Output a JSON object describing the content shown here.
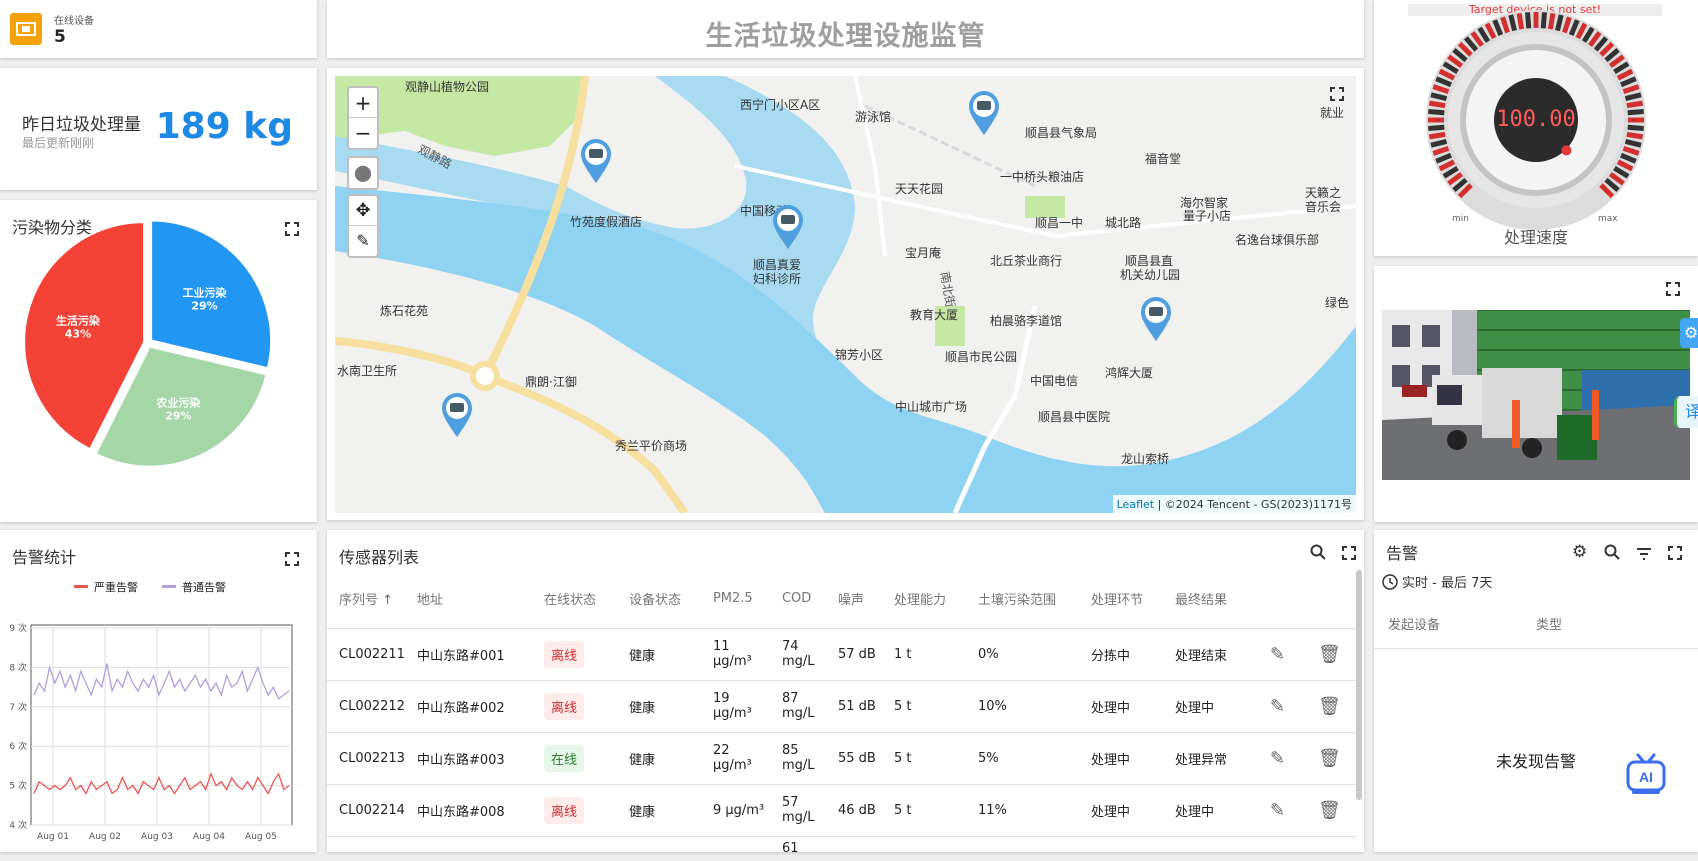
{
  "online": {
    "label": "在线设备",
    "value": "5",
    "icon": "device-icon",
    "color": "#f5a10a"
  },
  "waste": {
    "title": "昨日垃圾处理量",
    "subtitle": "最后更新刚刚",
    "value": "189 kg",
    "color": "#1e88e5"
  },
  "header": {
    "title": "生活垃圾处理设施监管"
  },
  "pie": {
    "title": "污染物分类",
    "chart_data": {
      "type": "pie",
      "slices": [
        {
          "name": "工业污染",
          "value": 29,
          "color": "#2196f3"
        },
        {
          "name": "农业污染",
          "value": 29,
          "color": "#a5d6a7"
        },
        {
          "name": "生活污染",
          "value": 43,
          "color": "#f44336"
        }
      ],
      "labels": [
        "工业污染 29%",
        "农业污染 29%",
        "生活污染 43%"
      ]
    }
  },
  "alarm_stats": {
    "title": "告警统计",
    "chart_data": {
      "type": "line",
      "series": [
        {
          "name": "严重告警",
          "color": "#ef5350",
          "values": [
            4.8,
            5.1,
            5.0,
            4.9,
            5.0,
            4.9,
            5.0,
            5.2,
            4.9,
            5.0,
            4.8,
            5.1,
            4.9,
            5.0,
            5.1,
            4.8,
            4.9,
            5.2,
            4.9,
            5.0,
            4.8,
            5.1,
            5.0,
            4.9,
            5.2,
            4.9,
            5.0,
            4.8,
            5.0,
            5.2,
            4.9,
            5.0,
            5.1,
            4.9,
            5.3,
            5.0,
            5.1,
            4.9,
            5.2,
            5.0,
            4.9,
            5.1,
            4.9,
            5.2,
            5.0,
            4.8,
            5.1,
            5.3,
            4.9,
            5.0
          ]
        },
        {
          "name": "普通告警",
          "color": "#b39ddb",
          "values": [
            7.3,
            7.6,
            7.4,
            8.0,
            7.6,
            7.9,
            7.5,
            7.8,
            7.4,
            7.9,
            7.6,
            7.3,
            7.7,
            7.5,
            8.1,
            7.4,
            7.7,
            7.5,
            7.9,
            7.6,
            7.4,
            7.7,
            7.5,
            7.8,
            7.3,
            7.6,
            7.9,
            7.5,
            7.7,
            7.4,
            7.6,
            7.8,
            7.5,
            7.7,
            7.4,
            7.6,
            7.3,
            7.8,
            7.5,
            7.6,
            7.9,
            7.4,
            7.7,
            8.0,
            7.6,
            7.3,
            7.5,
            7.2,
            7.3,
            7.4
          ]
        }
      ],
      "yticks": [
        "4 次",
        "5 次",
        "6 次",
        "7 次",
        "8 次",
        "9 次"
      ],
      "xticks": [
        "Aug 01",
        "Aug 02",
        "Aug 03",
        "Aug 04",
        "Aug 05"
      ],
      "ylim": [
        4,
        9
      ]
    }
  },
  "map": {
    "attribution_link": "Leaflet",
    "attribution_text": " | ©2024 Tencent - GS(2023)1171号",
    "pois": [
      {
        "t": "观静山植物公园"
      },
      {
        "t": "西宁门小区A区"
      },
      {
        "t": "游泳馆"
      },
      {
        "t": "顺昌县气象局"
      },
      {
        "t": "就业"
      },
      {
        "t": "福音堂"
      },
      {
        "t": "一中桥头粮油店"
      },
      {
        "t": "天天花园"
      },
      {
        "t": "竹苑度假酒店"
      },
      {
        "t": "中国移动"
      },
      {
        "t": "顺昌一中"
      },
      {
        "t": "海尔智家"
      },
      {
        "t": "量子小店"
      },
      {
        "t": "天籁之"
      },
      {
        "t": "音乐会"
      },
      {
        "t": "宝月庵"
      },
      {
        "t": "北丘茶业商行"
      },
      {
        "t": "顺昌真爱"
      },
      {
        "t": "妇科诊所"
      },
      {
        "t": "城北路"
      },
      {
        "t": "顺昌县直"
      },
      {
        "t": "机关幼儿园"
      },
      {
        "t": "名逸台球俱乐部"
      },
      {
        "t": "炼石花苑"
      },
      {
        "t": "教育大厦"
      },
      {
        "t": "柏晨骆李道馆"
      },
      {
        "t": "绿色"
      },
      {
        "t": "锦芳小区"
      },
      {
        "t": "顺昌市民公园"
      },
      {
        "t": "水南卫生所"
      },
      {
        "t": "鼎朗·江御"
      },
      {
        "t": "中国电信"
      },
      {
        "t": "鸿辉大厦"
      },
      {
        "t": "中山城市广场"
      },
      {
        "t": "顺昌县中医院"
      },
      {
        "t": "秀兰平价商场"
      },
      {
        "t": "龙山索桥"
      },
      {
        "t": "观静路"
      },
      {
        "t": "南北街"
      }
    ]
  },
  "sensor": {
    "title": "传感器列表",
    "columns": [
      "序列号 ↑",
      "地址",
      "在线状态",
      "设备状态",
      "PM2.5",
      "COD",
      "噪声",
      "处理能力",
      "土壤污染范围",
      "处理环节",
      "最终结果"
    ],
    "rows": [
      {
        "id": "CL002211",
        "addr": "中山东路#001",
        "online": "离线",
        "dev": "健康",
        "pm": "11 μg/m³",
        "cod1": "74",
        "cod2": "mg/L",
        "noise": "57 dB",
        "cap": "1 t",
        "soil": "0%",
        "stage": "分拣中",
        "result": "处理结束"
      },
      {
        "id": "CL002212",
        "addr": "中山东路#002",
        "online": "离线",
        "dev": "健康",
        "pm": "19 μg/m³",
        "cod1": "87",
        "cod2": "mg/L",
        "noise": "51 dB",
        "cap": "5 t",
        "soil": "10%",
        "stage": "处理中",
        "result": "处理中"
      },
      {
        "id": "CL002213",
        "addr": "中山东路#003",
        "online": "在线",
        "dev": "健康",
        "pm": "22 μg/m³",
        "cod1": "85",
        "cod2": "mg/L",
        "noise": "55 dB",
        "cap": "5 t",
        "soil": "5%",
        "stage": "处理中",
        "result": "处理异常"
      },
      {
        "id": "CL002214",
        "addr": "中山东路#008",
        "online": "离线",
        "dev": "健康",
        "pm": "9 μg/m³",
        "cod1": "57",
        "cod2": "mg/L",
        "noise": "46 dB",
        "cap": "5 t",
        "soil": "11%",
        "stage": "处理中",
        "result": "处理中"
      },
      {
        "id": "",
        "addr": "",
        "online": "",
        "dev": "",
        "pm": "",
        "cod1": "61",
        "cod2": "",
        "noise": "",
        "cap": "",
        "soil": "",
        "stage": "",
        "result": ""
      }
    ]
  },
  "gauge": {
    "warning": "Target device is not set!",
    "value": "100.00",
    "min": "min",
    "max": "max",
    "label": "处理速度",
    "level": 1.0
  },
  "alarm": {
    "title": "告警",
    "range": "实时 - 最后 7天",
    "col1": "发起设备",
    "col2": "类型",
    "empty": "未发现告警"
  },
  "side": {
    "translate": "译"
  }
}
